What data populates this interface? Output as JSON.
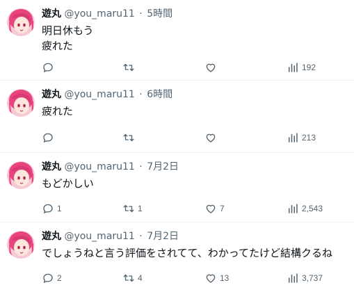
{
  "tweets": [
    {
      "name": "遊丸",
      "handle": "@you_maru11",
      "separator": "·",
      "time": "5時間",
      "lines": [
        "明日休もう",
        "疲れた"
      ],
      "replies": "",
      "retweets": "",
      "likes": "",
      "views": "192"
    },
    {
      "name": "遊丸",
      "handle": "@you_maru11",
      "separator": "·",
      "time": "6時間",
      "lines": [
        "疲れた"
      ],
      "replies": "",
      "retweets": "",
      "likes": "",
      "views": "213"
    },
    {
      "name": "遊丸",
      "handle": "@you_maru11",
      "separator": "·",
      "time": "7月2日",
      "lines": [
        "もどかしい"
      ],
      "replies": "1",
      "retweets": "1",
      "likes": "7",
      "views": "2,543"
    },
    {
      "name": "遊丸",
      "handle": "@you_maru11",
      "separator": "·",
      "time": "7月2日",
      "lines": [
        "でしょうねと言う評価をされてて、わかってたけど結構クるね"
      ],
      "replies": "2",
      "retweets": "4",
      "likes": "13",
      "views": "3,737"
    }
  ],
  "icons": {
    "reply": "speech-bubble-icon",
    "retweet": "retweet-arrows-icon",
    "like": "heart-icon",
    "views": "bar-chart-icon"
  },
  "colors": {
    "text_primary": "#0f1419",
    "text_secondary": "#536471",
    "divider": "#eff3f4",
    "avatar_hair": "#e8457e"
  }
}
